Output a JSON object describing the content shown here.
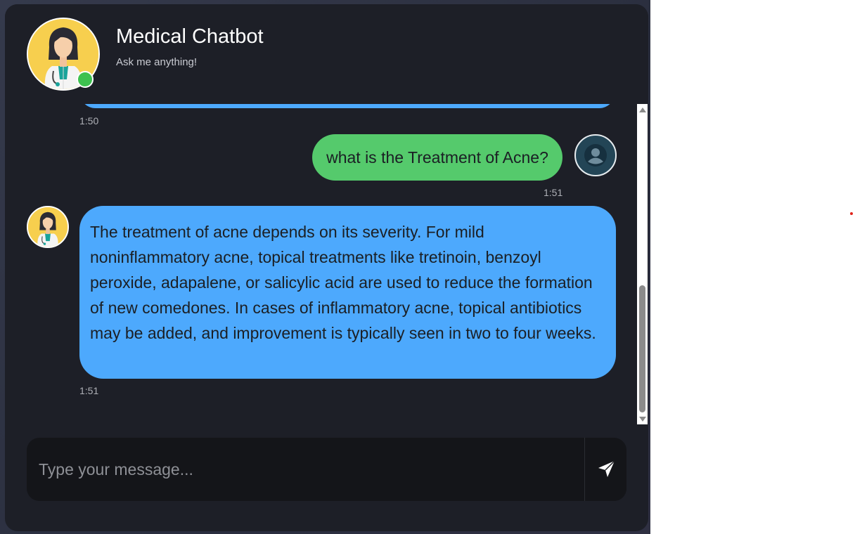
{
  "header": {
    "title": "Medical Chatbot",
    "subtitle": "Ask me anything!",
    "status": "online"
  },
  "messages": [
    {
      "role": "bot",
      "text": "",
      "time": "1:50"
    },
    {
      "role": "user",
      "text": "what is the Treatment of Acne?",
      "time": "1:51"
    },
    {
      "role": "bot",
      "text": "The treatment of acne depends on its severity. For mild noninflammatory acne, topical treatments like tretinoin, benzoyl peroxide, adapalene, or salicylic acid are used to reduce the formation of new comedones. In cases of inflammatory acne, topical antibiotics may be added, and improvement is typically seen in two to four weeks.",
      "time": "1:51"
    }
  ],
  "input": {
    "placeholder": "Type your message...",
    "value": ""
  },
  "icons": {
    "send": "send-icon",
    "user": "user-icon",
    "doctor": "doctor-avatar",
    "online": "online-status-icon"
  },
  "colors": {
    "bot_bubble": "#4da9fd",
    "user_bubble": "#55ca6c",
    "card_background": "#1d1f27",
    "online": "#3dc14f",
    "avatar_background": "#f7cf4e"
  },
  "scroll": {
    "position": 1.0
  }
}
